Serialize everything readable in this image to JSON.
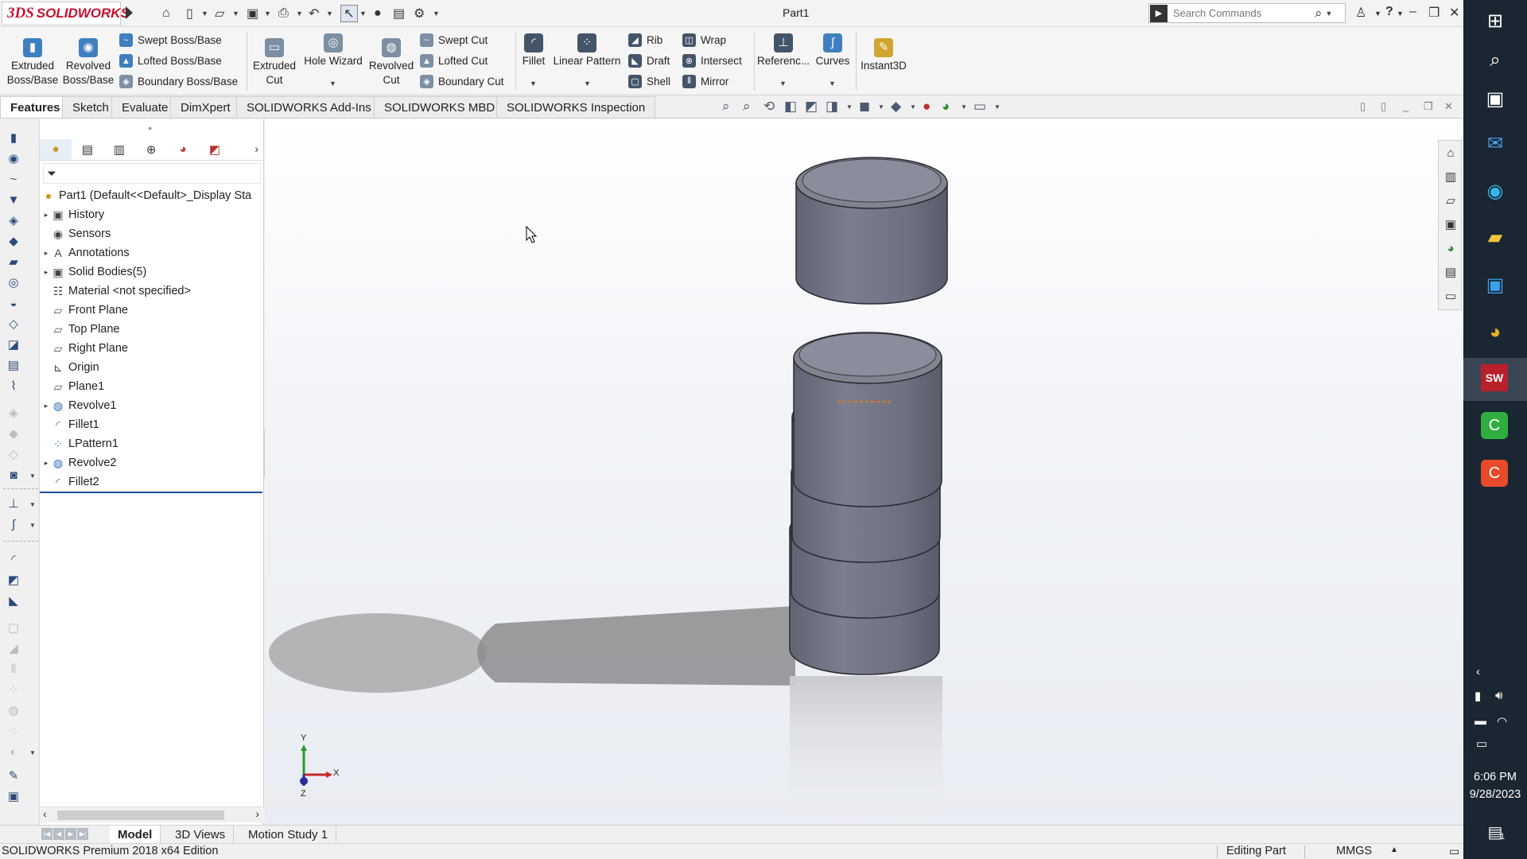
{
  "app": {
    "logo_mark": "3DS",
    "logo_text": "SOLIDWORKS",
    "document_title": "Part1",
    "search_placeholder": "Search Commands",
    "help_label": "?"
  },
  "ribbon": {
    "extruded_boss": "Extruded Boss/Base",
    "revolved_boss": "Revolved Boss/Base",
    "swept_boss": "Swept Boss/Base",
    "lofted_boss": "Lofted Boss/Base",
    "boundary_boss": "Boundary Boss/Base",
    "extruded_cut": "Extruded Cut",
    "hole_wizard": "Hole Wizard",
    "revolved_cut": "Revolved Cut",
    "swept_cut": "Swept Cut",
    "lofted_cut": "Lofted Cut",
    "boundary_cut": "Boundary Cut",
    "fillet": "Fillet",
    "linear_pattern": "Linear Pattern",
    "rib": "Rib",
    "draft": "Draft",
    "shell": "Shell",
    "wrap": "Wrap",
    "intersect": "Intersect",
    "mirror": "Mirror",
    "reference": "Referenc...",
    "curves": "Curves",
    "instant3d": "Instant3D"
  },
  "command_tabs": [
    "Features",
    "Sketch",
    "Evaluate",
    "DimXpert",
    "SOLIDWORKS Add-Ins",
    "SOLIDWORKS MBD",
    "SOLIDWORKS Inspection"
  ],
  "feature_tree": {
    "root": "Part1  (Default<<Default>_Display Sta",
    "items": [
      {
        "label": "History",
        "expandable": true,
        "icon": "history-folder-icon"
      },
      {
        "label": "Sensors",
        "expandable": false,
        "icon": "sensors-icon"
      },
      {
        "label": "Annotations",
        "expandable": true,
        "icon": "annotations-icon"
      },
      {
        "label": "Solid Bodies(5)",
        "expandable": true,
        "icon": "solid-bodies-icon"
      },
      {
        "label": "Material <not specified>",
        "expandable": false,
        "icon": "material-icon"
      },
      {
        "label": "Front Plane",
        "expandable": false,
        "icon": "plane-icon"
      },
      {
        "label": "Top Plane",
        "expandable": false,
        "icon": "plane-icon"
      },
      {
        "label": "Right Plane",
        "expandable": false,
        "icon": "plane-icon"
      },
      {
        "label": "Origin",
        "expandable": false,
        "icon": "origin-icon"
      },
      {
        "label": "Plane1",
        "expandable": false,
        "icon": "plane-icon"
      },
      {
        "label": "Revolve1",
        "expandable": true,
        "icon": "revolve-icon"
      },
      {
        "label": "Fillet1",
        "expandable": false,
        "icon": "fillet-icon"
      },
      {
        "label": "LPattern1",
        "expandable": false,
        "icon": "linear-pattern-icon"
      },
      {
        "label": "Revolve2",
        "expandable": true,
        "icon": "revolve-icon"
      },
      {
        "label": "Fillet2",
        "expandable": false,
        "icon": "fillet-icon"
      }
    ]
  },
  "triad": {
    "y": "Y",
    "x": "X",
    "z": "Z"
  },
  "bottom_tabs": [
    "Model",
    "3D Views",
    "Motion Study 1"
  ],
  "status": {
    "edition": "SOLIDWORKS Premium 2018 x64 Edition",
    "mode": "Editing Part",
    "units": "MMGS"
  },
  "taskbar": {
    "time": "6:06 PM",
    "date": "9/28/2023",
    "notification_count": "1"
  },
  "colors": {
    "brand": "#c8102e",
    "part_top": "#8a8e9c",
    "part_side": "#767a8b"
  }
}
